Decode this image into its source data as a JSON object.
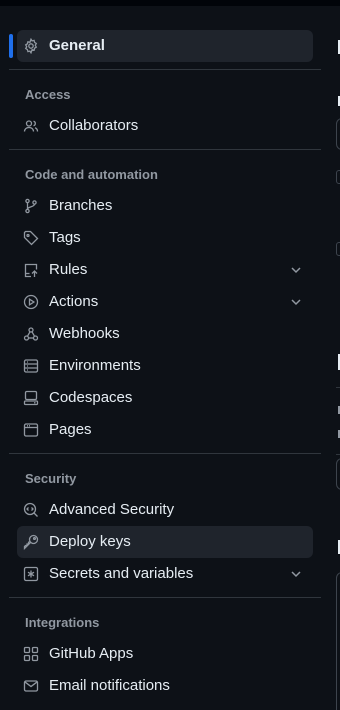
{
  "sidebar": {
    "general": {
      "label": "General",
      "icon": "gear-icon"
    },
    "sections": {
      "access": {
        "title": "Access"
      },
      "code_automation": {
        "title": "Code and automation"
      },
      "security": {
        "title": "Security"
      },
      "integrations": {
        "title": "Integrations"
      }
    },
    "items": {
      "collaborators": {
        "label": "Collaborators",
        "icon": "people-icon"
      },
      "branches": {
        "label": "Branches",
        "icon": "git-branch-icon"
      },
      "tags": {
        "label": "Tags",
        "icon": "tag-icon"
      },
      "rules": {
        "label": "Rules",
        "icon": "repo-push-icon"
      },
      "actions": {
        "label": "Actions",
        "icon": "play-icon"
      },
      "webhooks": {
        "label": "Webhooks",
        "icon": "webhook-icon"
      },
      "environments": {
        "label": "Environments",
        "icon": "server-icon"
      },
      "codespaces": {
        "label": "Codespaces",
        "icon": "codespaces-icon"
      },
      "pages": {
        "label": "Pages",
        "icon": "browser-icon"
      },
      "advanced_security": {
        "label": "Advanced Security",
        "icon": "codescan-icon"
      },
      "deploy_keys": {
        "label": "Deploy keys",
        "icon": "key-icon"
      },
      "secrets_variables": {
        "label": "Secrets and variables",
        "icon": "asterisk-icon"
      },
      "github_apps": {
        "label": "GitHub Apps",
        "icon": "apps-icon"
      },
      "email_notifications": {
        "label": "Email notifications",
        "icon": "mail-icon"
      }
    }
  },
  "colors": {
    "background": "#0d1117",
    "active_item_bg": "#1f242c",
    "accent": "#1f6feb",
    "text": "#e6edf3",
    "muted": "#9198a1",
    "border": "#30363d"
  }
}
